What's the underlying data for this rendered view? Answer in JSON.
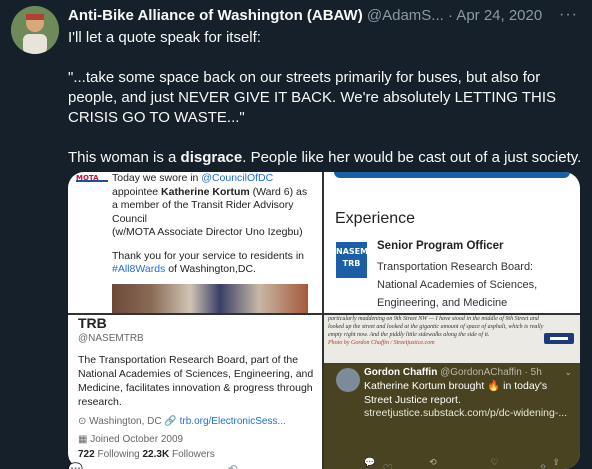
{
  "tweet": {
    "author_name": "Anti-Bike Alliance of Washington (ABAW)",
    "handle_date": " @AdamS... · Apr 24, 2020",
    "more": "···",
    "lines": [
      "I'll let a quote speak for itself:",
      "\"...take some space back on our streets primarily for buses, but also for people, and just NEVER GIVE IT BACK. We're absolutely LETTING THIS CRISIS GO TO WASTE...\""
    ],
    "last_line_pre": "This woman is a ",
    "last_line_bold": "disgrace",
    "last_line_post": ". People like her would be cast out of a just society."
  },
  "panel1": {
    "logo": "MOTA",
    "t1": "Today we swore in ",
    "t1_link": "@CouncilOfDC",
    "t2": "appointee ",
    "t2_bold": "Katherine Kortum",
    "t2_post": " (Ward 6) as",
    "t3": "a member of the Transit Rider Advisory",
    "t4": "Council",
    "t5": "(w/MOTA Associate Director Uno Izegbu)",
    "t6": "Thank you for your service to residents in",
    "t7_link": "#All8Wards",
    "t7_post": " of Washington,DC."
  },
  "panel2": {
    "title": "Experience",
    "logo_line1": "NASEM",
    "logo_line2": "TRB",
    "role": "Senior Program Officer",
    "org": "Transportation Research Board: National Academies of Sciences, Engineering, and Medicine"
  },
  "panel3": {
    "name": "TRB",
    "handle": "@NASEMTRB",
    "bio": "The Transportation Research Board, part of the National Academies of Sciences, Engineering, and Medicine, facilitates innovation & progress through research.",
    "location": "Washington, DC",
    "link": "trb.org/ElectronicSess...",
    "joined": "Joined October 2009",
    "following_count": "722",
    "following_label": " Following  ",
    "followers_count": "22.3K",
    "followers_label": " Followers"
  },
  "panel4": {
    "article_pre": "particularly maddening on 9th Street NW — I have stood in the middle of 9th Street and looked up the street and looked at the gigantic amount of space of asphalt, which is really empty right now. And the piddly little sidewalks along the side of it.",
    "article_credit": "Photo by Gordon Chaffin / Streetjustice.com",
    "tweet_name": "Gordon Chaffin",
    "tweet_handle": " @GordonAChaffin · 5h",
    "chevron": "⌄",
    "tweet_body_1": "Katherine Kortum brought 🔥 in today's Street Justice report.",
    "tweet_link": "streetjustice.substack.com/p/dc-widening-...",
    "actions": [
      "💬",
      "⟲",
      "♡",
      "⇪"
    ]
  },
  "footer_actions": [
    "💬",
    "⟲",
    "♡",
    "⇪"
  ]
}
